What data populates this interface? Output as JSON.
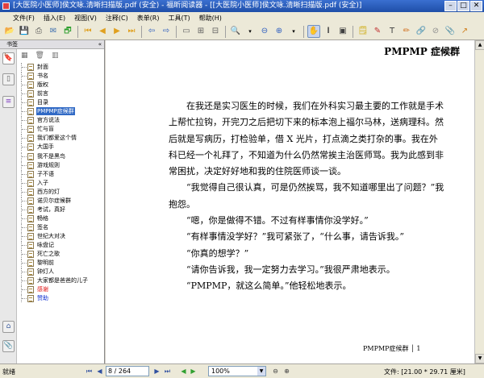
{
  "window": {
    "title": "[大医院小医师]侯文咏.清晰扫描版.pdf (安全) - 福昕阅读器 - [[大医院小医师]侯文咏.清晰扫描版.pdf (安全)]",
    "minimize": "–",
    "maximize": "□",
    "close": "✕"
  },
  "menu": [
    "文件(F)",
    "插入(E)",
    "视图(V)",
    "注释(C)",
    "表单(R)",
    "工具(T)",
    "帮助(H)"
  ],
  "toolbar": {
    "icons": [
      "open-folder-icon",
      "save-icon",
      "print-icon",
      "email-icon",
      "open-web-icon",
      "first-page-icon",
      "prev-page-icon",
      "next-page-icon",
      "last-page-icon",
      "back-icon",
      "forward-icon",
      "actual-size-icon",
      "fit-page-icon",
      "fit-width-icon",
      "zoom-in-icon",
      "zoom-out-icon",
      "rotate-icon",
      "hand-tool-icon",
      "select-text-icon",
      "snapshot-icon",
      "note-icon",
      "highlight-icon",
      "typewriter-icon",
      "pencil-icon",
      "link-icon",
      "stamp-icon",
      "attach-icon",
      "arrow-icon"
    ]
  },
  "sidebar": {
    "title": "书签",
    "collapse": "«",
    "tabs": [
      "bookmarks-tab-icon",
      "pages-tab-icon",
      "layers-tab-icon"
    ],
    "bottom_tabs": [
      "attachments-tab-icon",
      "clip-tab-icon"
    ],
    "tools": [
      "▦",
      "🗑",
      "▥"
    ],
    "bookmarks": [
      {
        "label": "封面",
        "style": ""
      },
      {
        "label": "书名",
        "style": ""
      },
      {
        "label": "版权",
        "style": ""
      },
      {
        "label": "前言",
        "style": ""
      },
      {
        "label": "目录",
        "style": ""
      },
      {
        "label": "PMPMP症候群",
        "style": "sel"
      },
      {
        "label": "官方说法",
        "style": ""
      },
      {
        "label": "忙与盲",
        "style": ""
      },
      {
        "label": "我们都爱这个情",
        "style": ""
      },
      {
        "label": "大国手",
        "style": ""
      },
      {
        "label": "我不是黑鸟",
        "style": ""
      },
      {
        "label": "游戏规则",
        "style": ""
      },
      {
        "label": "子不语",
        "style": ""
      },
      {
        "label": "入子",
        "style": ""
      },
      {
        "label": "西方的灯",
        "style": ""
      },
      {
        "label": "诺贝尔症候群",
        "style": ""
      },
      {
        "label": "考试，真好",
        "style": ""
      },
      {
        "label": "畅格",
        "style": ""
      },
      {
        "label": "签名",
        "style": ""
      },
      {
        "label": "世纪大对决",
        "style": ""
      },
      {
        "label": "咏盘记",
        "style": ""
      },
      {
        "label": "死亡之歌",
        "style": ""
      },
      {
        "label": "黎明前",
        "style": ""
      },
      {
        "label": "钟灯人",
        "style": ""
      },
      {
        "label": "大家都是爸爸的儿子",
        "style": ""
      },
      {
        "label": "感谢",
        "style": "red"
      },
      {
        "label": "赞助",
        "style": "blue"
      }
    ]
  },
  "page": {
    "header": "PMPMP 症候群",
    "paragraphs": [
      "在我还是实习医生的时候，我们在外科实习最主要的工作就是手术上帮忙拉钩，开完刀之后把切下来的标本泡上福尔马林，送病理科。然后就是写病历，打检验单，借 X 光片，打点滴之类打杂的事。我在外科已经一个礼拜了，不知道为什么仍然常挨主治医师骂。我为此感到非常困扰，决定好好地和我的住院医师谈一谈。",
      "“我觉得自己很认真，可是仍然挨骂，我不知道哪里出了问题？”我抱怨。",
      "“嗯，你是做得不错。不过有样事情你没学好。”",
      "“有样事情没学好？”我可紧张了，“什么事，请告诉我。”",
      "“你真的想学？”",
      "“请你告诉我，我一定努力去学习。”我很严肃地表示。",
      "“PMPMP，就这么简单。”他轻松地表示。"
    ],
    "footer": "PMPMP症候群 │ 1"
  },
  "status": {
    "text": "就绪",
    "page_field": "8 / 264",
    "zoom": "100%",
    "page_size": "文件: [21.00 * 29.71 厘米]"
  }
}
